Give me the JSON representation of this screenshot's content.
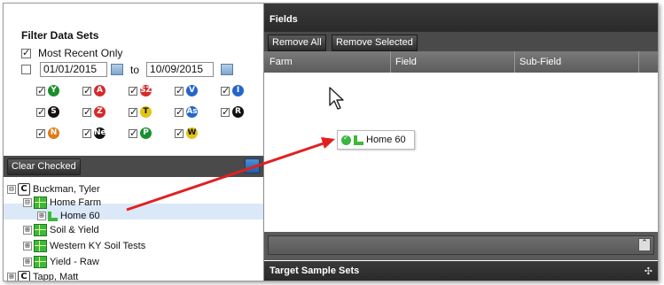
{
  "filter": {
    "title": "Filter Data Sets",
    "most_recent_label": "Most Recent Only",
    "most_recent_checked": true,
    "date_range_checked": false,
    "date_from": "01/01/2015",
    "date_to_label": "to",
    "date_to": "10/09/2015"
  },
  "routes": [
    {
      "symbol": "Y",
      "color": "#1a8f2e",
      "checked": true
    },
    {
      "symbol": "A",
      "color": "#d62a2a",
      "checked": true
    },
    {
      "symbol": "SZ",
      "color": "#d62a2a",
      "checked": true
    },
    {
      "symbol": "V",
      "color": "#2466c9",
      "checked": true
    },
    {
      "symbol": "I",
      "color": "#2466c9",
      "checked": true
    },
    {
      "symbol": "S",
      "color": "#111111",
      "checked": true
    },
    {
      "symbol": "Z",
      "color": "#d62a2a",
      "checked": true
    },
    {
      "symbol": "T",
      "color": "#e3c317",
      "checked": true
    },
    {
      "symbol": "As",
      "color": "#2466c9",
      "checked": true
    },
    {
      "symbol": "R",
      "color": "#111111",
      "checked": true
    },
    {
      "symbol": "N",
      "color": "#e07b17",
      "checked": true
    },
    {
      "symbol": "Ne",
      "color": "#111111",
      "checked": true
    },
    {
      "symbol": "P",
      "color": "#1a8f2e",
      "checked": true
    },
    {
      "symbol": "W",
      "color": "#e3c317",
      "checked": true
    }
  ],
  "toolbar": {
    "clear_checked_label": "Clear Checked"
  },
  "tree": {
    "nodes": [
      {
        "label": "Buckman, Tyler",
        "icon": "customer-icon",
        "expander": "⊟"
      },
      {
        "label": "Home Farm",
        "icon": "farm-icon",
        "expander": "⊟"
      },
      {
        "label": "Home 60",
        "icon": "field-icon",
        "expander": "⊞",
        "selected": true
      },
      {
        "label": "Soil & Yield",
        "icon": "farm-icon",
        "expander": "⊞"
      },
      {
        "label": "Western KY Soil Tests",
        "icon": "farm-icon",
        "expander": "⊞"
      },
      {
        "label": "Yield - Raw",
        "icon": "farm-icon",
        "expander": "⊞"
      },
      {
        "label": "Tapp, Matt",
        "icon": "customer-icon",
        "expander": "⊞"
      }
    ]
  },
  "fields_panel": {
    "title": "Fields",
    "remove_all_label": "Remove All",
    "remove_selected_label": "Remove Selected",
    "columns": [
      "Farm",
      "Field",
      "Sub-Field"
    ],
    "drag_item_label": "Home 60"
  },
  "target_panel": {
    "title": "Target Sample Sets"
  },
  "colors": {
    "accent_dark": "#2a2a2a",
    "selection": "#dbe8f8",
    "annotation_arrow": "#e02020"
  }
}
